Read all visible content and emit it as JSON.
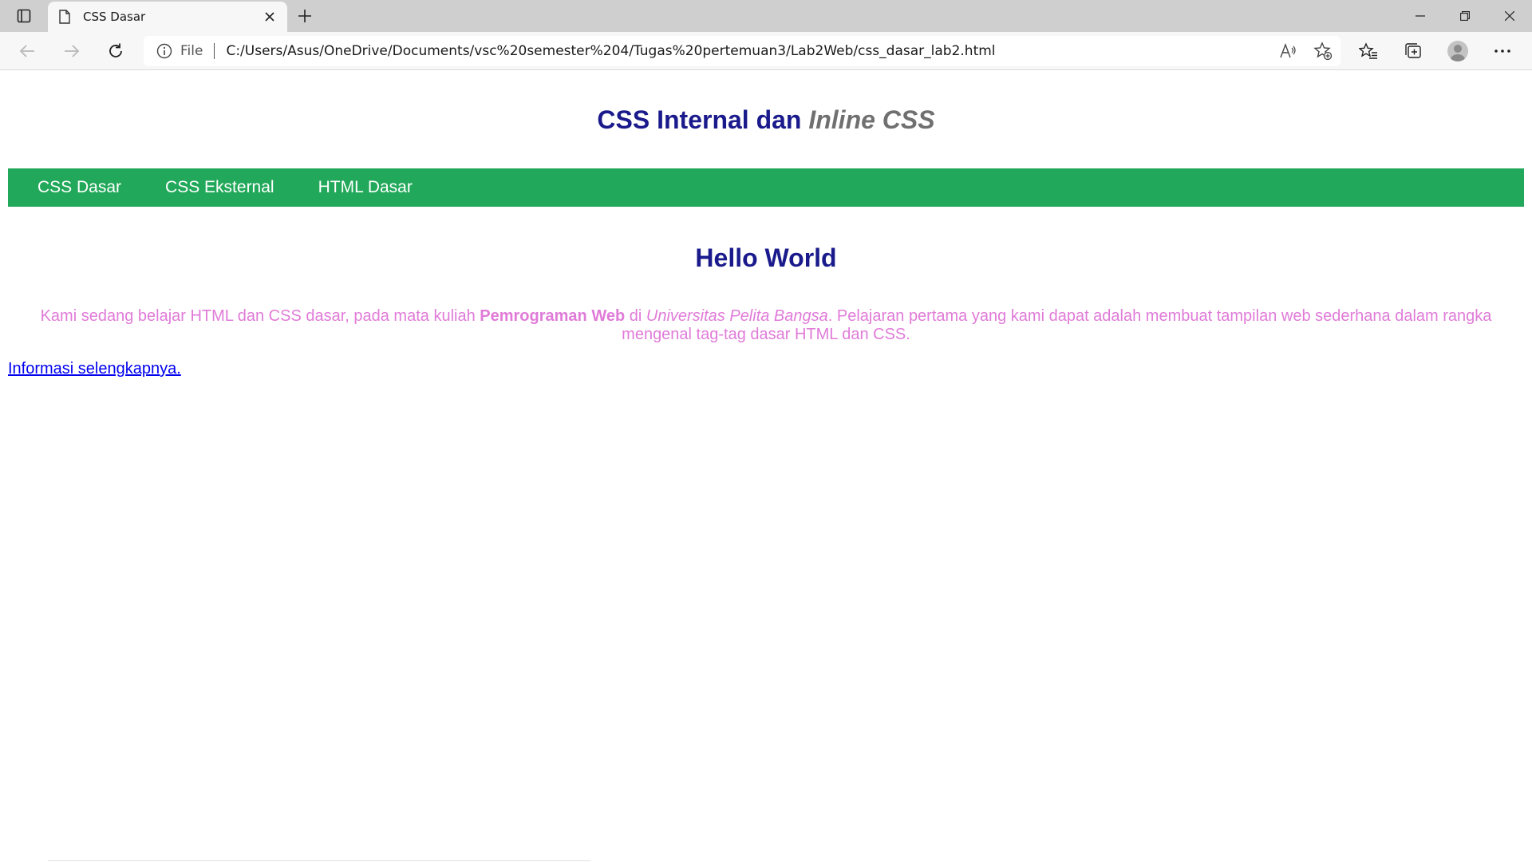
{
  "browser": {
    "tab_title": "CSS Dasar",
    "scheme_label": "File",
    "url": "C:/Users/Asus/OneDrive/Documents/vsc%20semester%204/Tugas%20pertemuan3/Lab2Web/css_dasar_lab2.html"
  },
  "page": {
    "header_main": "CSS Internal dan ",
    "header_italic": "Inline CSS",
    "nav": [
      "CSS Dasar",
      "CSS Eksternal",
      "HTML Dasar"
    ],
    "heading": "Hello World",
    "paragraph": {
      "part1": "Kami sedang belajar HTML dan CSS dasar, pada mata kuliah ",
      "bold": "Pemrograman Web",
      "part2": " di ",
      "italic": "Universitas Pelita Bangsa",
      "part3": ". Pelajaran pertama yang kami dapat adalah membuat tampilan web sederhana dalam rangka mengenal tag-tag dasar HTML dan CSS."
    },
    "link_text": "Informasi selengkapnya."
  },
  "colors": {
    "nav_bg": "#21a85a",
    "heading": "#1a1a8c",
    "header_italic": "#707070",
    "paragraph": "#e07bd8",
    "link": "#0000ee"
  }
}
